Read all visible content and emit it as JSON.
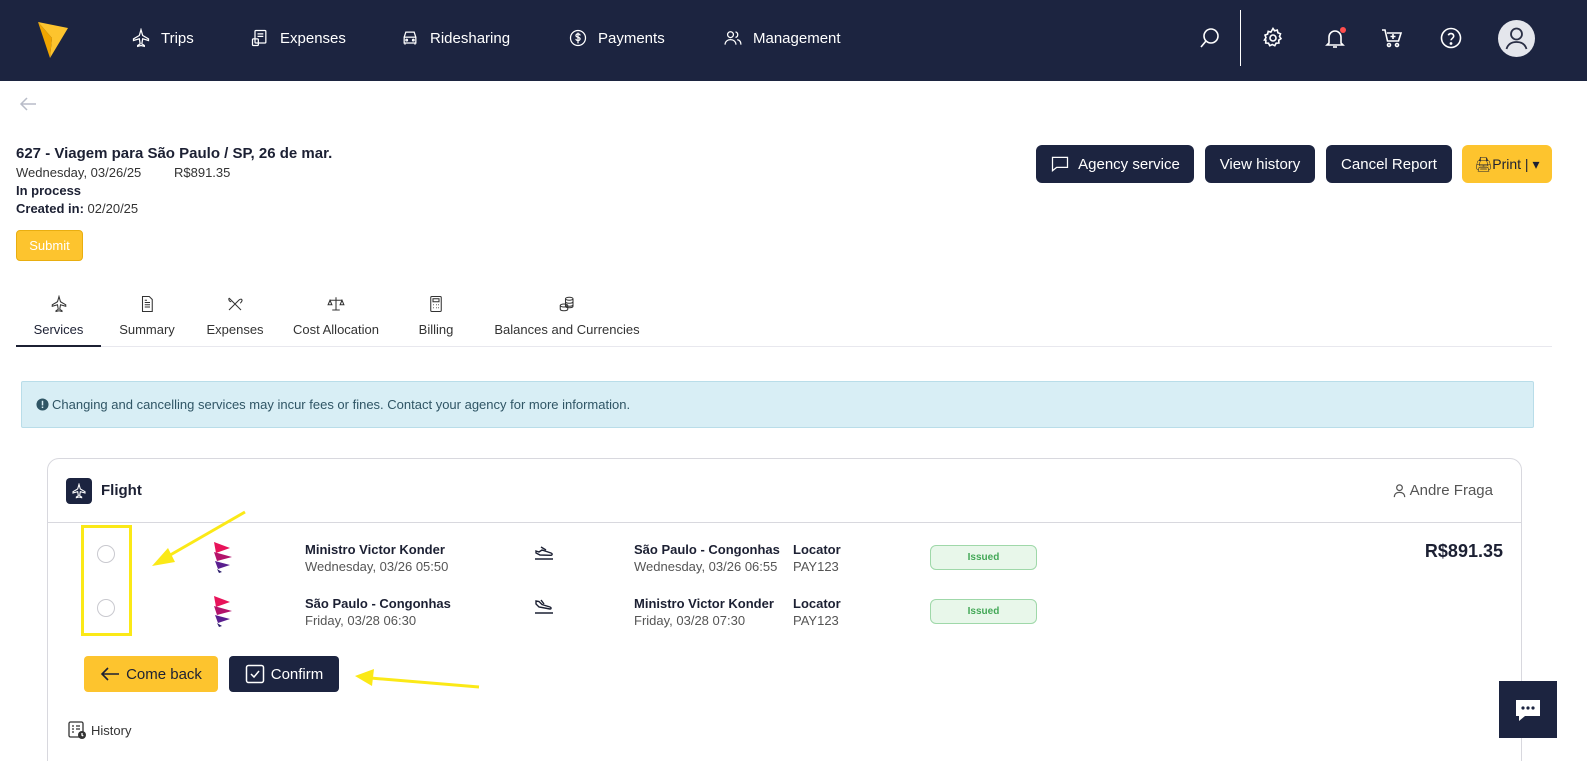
{
  "nav": {
    "items": [
      {
        "label": "Trips",
        "icon": "plane-icon"
      },
      {
        "label": "Expenses",
        "icon": "receipt-icon"
      },
      {
        "label": "Ridesharing",
        "icon": "car-icon"
      },
      {
        "label": "Payments",
        "icon": "dollar-circle-icon"
      },
      {
        "label": "Management",
        "icon": "users-icon"
      }
    ],
    "right_icons": [
      "search-icon",
      "gear-icon",
      "bell-icon",
      "cart-icon",
      "help-icon",
      "avatar-icon"
    ]
  },
  "colors": {
    "navy": "#1c2440",
    "accent_yellow": "#fdc42e",
    "alert_bg": "#d8eef5",
    "issued_green": "#43a857",
    "annotation_yellow": "#fbe917"
  },
  "report": {
    "title": "627 - Viagem para São Paulo / SP, 26 de mar.",
    "date": "Wednesday, 03/26/25",
    "amount": "R$891.35",
    "status": "In process",
    "created_label": "Created in:",
    "created_value": "02/20/25"
  },
  "actions": {
    "agency": "Agency service",
    "history": "View history",
    "cancel": "Cancel Report",
    "print": "🖨Print | ▾",
    "submit": "Submit"
  },
  "tabs": [
    {
      "label": "Services",
      "icon": "plane-icon"
    },
    {
      "label": "Summary",
      "icon": "document-icon"
    },
    {
      "label": "Expenses",
      "icon": "utensils-icon"
    },
    {
      "label": "Cost Allocation",
      "icon": "scale-icon"
    },
    {
      "label": "Billing",
      "icon": "calculator-icon"
    },
    {
      "label": "Balances and Currencies",
      "icon": "coins-icon"
    }
  ],
  "alert": {
    "text": "Changing and cancelling services may incur fees or fines. Contact your agency for more information."
  },
  "flight": {
    "title": "Flight",
    "traveler": "Andre Fraga",
    "total": "R$891.35",
    "segments": [
      {
        "origin": "Ministro Victor Konder",
        "departure": "Wednesday, 03/26 05:50",
        "destination": "São Paulo - Congonhas",
        "arrival": "Wednesday, 03/26 06:55",
        "locator_label": "Locator",
        "locator": "PAY123",
        "status": "Issued"
      },
      {
        "origin": "São Paulo - Congonhas",
        "departure": "Friday, 03/28 06:30",
        "destination": "Ministro Victor Konder",
        "arrival": "Friday, 03/28 07:30",
        "locator_label": "Locator",
        "locator": "PAY123",
        "status": "Issued"
      }
    ],
    "come_back": "Come back",
    "confirm": "Confirm",
    "history": "History"
  }
}
